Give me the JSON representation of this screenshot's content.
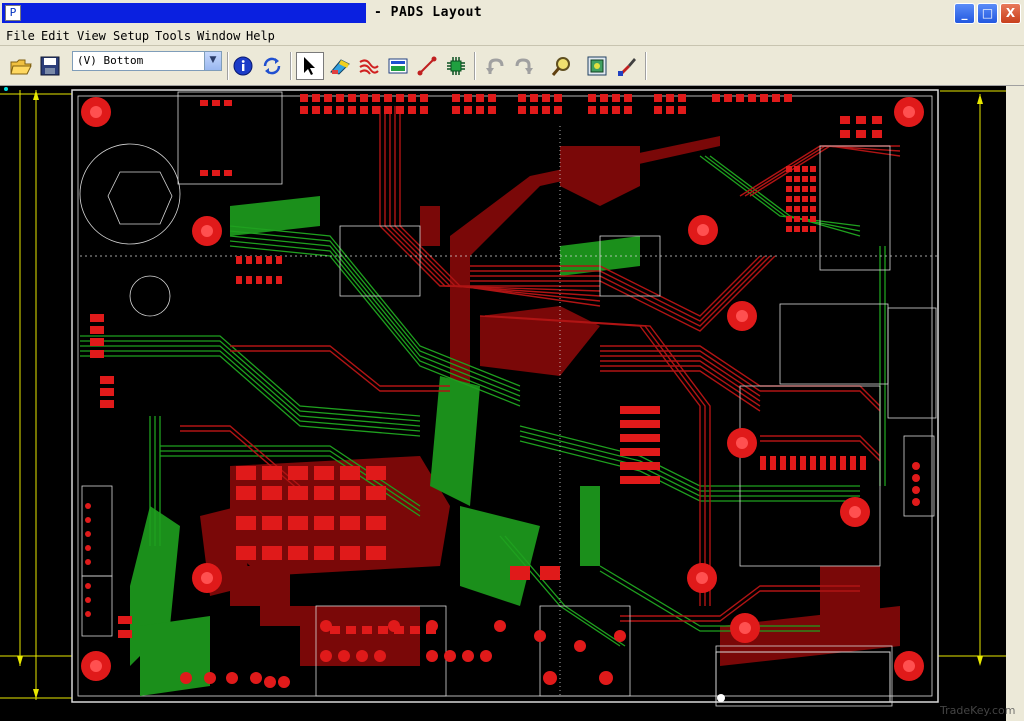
{
  "window": {
    "title": "- PADS Layout",
    "minimize_label": "_",
    "maximize_label": "□",
    "close_label": "X"
  },
  "menu": {
    "items": [
      {
        "label": "File"
      },
      {
        "label": "Edit"
      },
      {
        "label": "View"
      },
      {
        "label": "Setup"
      },
      {
        "label": "Tools"
      },
      {
        "label": "Window"
      },
      {
        "label": "Help"
      }
    ]
  },
  "toolbar": {
    "layer_select_value": "(V) Bottom",
    "icons": [
      "open-folder-icon",
      "save-icon",
      "info-icon",
      "refresh-icon",
      "select-arrow-icon",
      "drafting-icon",
      "routing-icon",
      "ecо-icon",
      "route-icon",
      "via-icon",
      "undo-icon",
      "redo-icon",
      "zoom-icon",
      "layout-toolbar-icon",
      "paint-icon"
    ]
  },
  "watermark": "TradeKey.com",
  "colors": {
    "board_background": "#000000",
    "top_copper": "#8b0a0a",
    "bottom_copper": "#1a9a1a",
    "pads": "#ff2020",
    "outline": "#ffff00",
    "silkscreen": "#e0e0e0"
  }
}
